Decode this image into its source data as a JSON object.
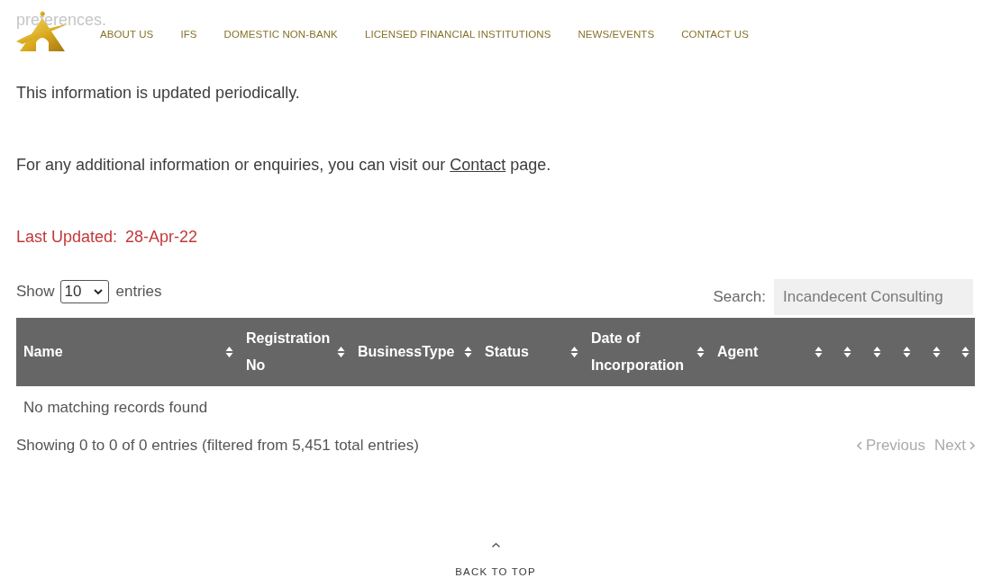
{
  "intro_fragment": "preferences.",
  "nav": {
    "items": [
      "ABOUT US",
      "IFS",
      "DOMESTIC NON-BANK",
      "LICENSED FINANCIAL INSTITUTIONS",
      "NEWS/EVENTS",
      "CONTACT US"
    ]
  },
  "update_note": "This information is updated periodically.",
  "contact_note": {
    "before": "For any additional information or enquiries, you can visit our",
    "link": "Contact",
    "after": "page."
  },
  "last_updated": {
    "label": "Last Updated:",
    "date": "28-Apr-22"
  },
  "length_control": {
    "label_before": "Show",
    "value": "10",
    "label_after": "entries"
  },
  "search": {
    "label": "Search:",
    "value": "Incandecent Consulting"
  },
  "table": {
    "columns": [
      {
        "label": "Name",
        "sortable": true
      },
      {
        "label": "Registration No",
        "sortable": true
      },
      {
        "label": "BusinessType",
        "sortable": true
      },
      {
        "label": "Status",
        "sortable": true
      },
      {
        "label": "Date of Incorporation",
        "sortable": true
      },
      {
        "label": "Agent",
        "sortable": true
      },
      {
        "sortable": true
      },
      {
        "sortable": true
      },
      {
        "sortable": true
      },
      {
        "sortable": true
      },
      {
        "sortable": true
      }
    ],
    "empty_message": "No matching records found"
  },
  "info": "Showing 0 to 0 of 0 entries (filtered from 5,451 total entries)",
  "pagination": [
    {
      "kind": "previous",
      "label": "Previous",
      "disabled": true
    },
    {
      "kind": "next",
      "label": "Next",
      "disabled": true
    }
  ],
  "back_to_top": {
    "label": "BACK TO TOP"
  }
}
